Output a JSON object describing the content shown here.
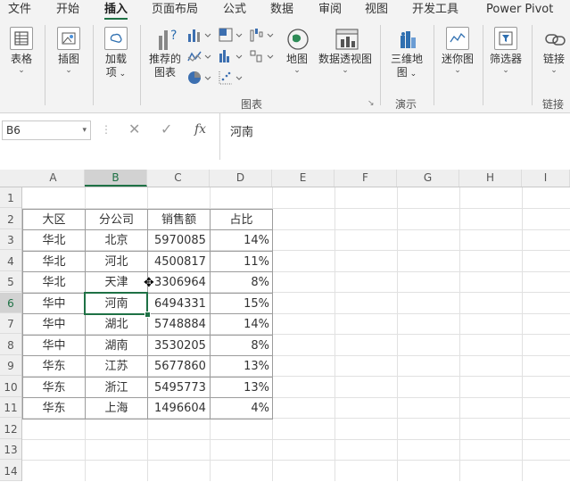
{
  "menu_tabs": [
    "文件",
    "开始",
    "插入",
    "页面布局",
    "公式",
    "数据",
    "审阅",
    "视图",
    "开发工具",
    "Power Pivot"
  ],
  "active_tab": "插入",
  "ribbon": {
    "table_btn": "表格",
    "illustrations_btn": "插图",
    "addins_btn_line1": "加载",
    "addins_btn_line2": "项",
    "recommended_charts_line1": "推荐的",
    "recommended_charts_line2": "图表",
    "maps_btn": "地图",
    "pivot_chart_btn": "数据透视图",
    "charts_group": "图表",
    "map3d_line1": "三维地",
    "map3d_line2": "图",
    "tours_group": "演示",
    "sparklines_btn": "迷你图",
    "filters_btn": "筛选器",
    "links_btn": "链接",
    "links_group": "链接"
  },
  "formula_bar": {
    "name_box": "B6",
    "cancel_icon": "✕",
    "enter_icon": "✓",
    "fx_label": "fx",
    "formula_value": "河南"
  },
  "columns": [
    "A",
    "B",
    "C",
    "D",
    "E",
    "F",
    "G",
    "H",
    "I"
  ],
  "selected_column": "B",
  "rows": [
    "1",
    "2",
    "3",
    "4",
    "5",
    "6",
    "7",
    "8",
    "9",
    "10",
    "11",
    "12",
    "13",
    "14"
  ],
  "selected_row": "6",
  "table": {
    "headers": [
      "大区",
      "分公司",
      "销售额",
      "占比"
    ],
    "rows": [
      [
        "华北",
        "北京",
        "5970085",
        "14%"
      ],
      [
        "华北",
        "河北",
        "4500817",
        "11%"
      ],
      [
        "华北",
        "天津",
        "3306964",
        "8%"
      ],
      [
        "华中",
        "河南",
        "6494331",
        "15%"
      ],
      [
        "华中",
        "湖北",
        "5748884",
        "14%"
      ],
      [
        "华中",
        "湖南",
        "3530205",
        "8%"
      ],
      [
        "华东",
        "江苏",
        "5677860",
        "13%"
      ],
      [
        "华东",
        "浙江",
        "5495773",
        "13%"
      ],
      [
        "华东",
        "上海",
        "1496604",
        "4%"
      ]
    ]
  },
  "colors": {
    "accent_green": "#1e7145",
    "ribbon_bg": "#f3f3f3",
    "header_bg": "#efefef",
    "gridline": "#e1e1e1"
  },
  "icons": {
    "name_box_dropdown": "chevron-down-icon",
    "cancel": "close-icon",
    "enter": "check-icon",
    "fx": "function-icon"
  }
}
